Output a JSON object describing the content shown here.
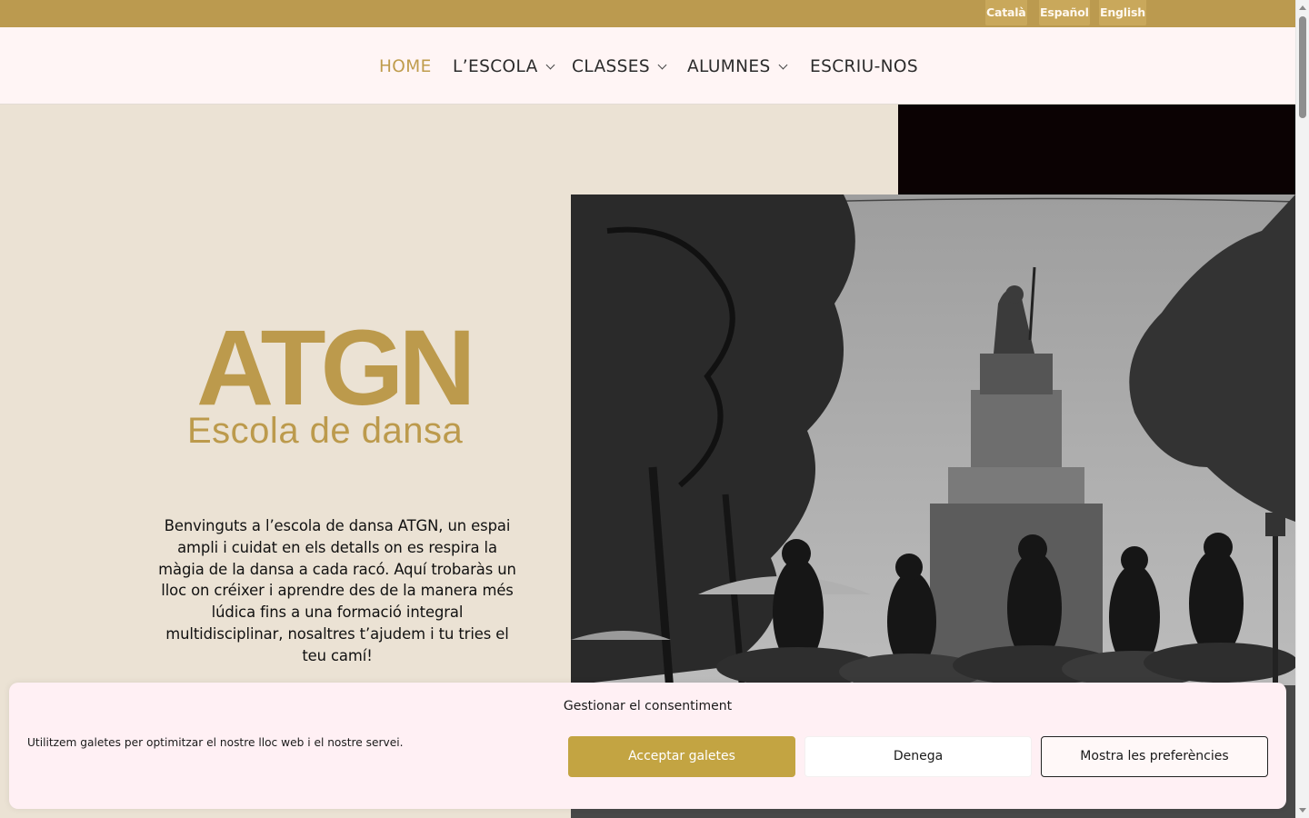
{
  "language_bar": {
    "languages": [
      "Català",
      "Español",
      "English"
    ],
    "background_color": "#bb9a4f"
  },
  "nav": {
    "items": [
      {
        "label": "HOME",
        "active": true
      },
      {
        "label": "L’ESCOLA",
        "has_dropdown": true
      },
      {
        "label": "CLASSES",
        "has_dropdown": true
      },
      {
        "label": "ALUMNES",
        "has_dropdown": true
      },
      {
        "label": "ESCRIU-NOS"
      }
    ],
    "active_color": "#bf9c4c"
  },
  "hero": {
    "logo_main": "ATGN",
    "logo_sub": "Escola de dansa",
    "logo_color": "#bc9a4c",
    "intro_text": "Benvinguts a l’escola de dansa ATGN, un espai ampli i cuidat en els detalls on es respira la màgia de la dansa a cada racó. Aquí trobaràs un lloc on créixer i aprendre des de la manera més lúdica fins a una formació integral multidisciplinar, nosaltres t’ajudem i tu tries el teu camí!",
    "background_color": "#ebe2d4"
  },
  "consent": {
    "title": "Gestionar el consentiment",
    "message": "Utilitzem galetes per optimitzar el nostre lloc web i el nostre servei.",
    "accept_label": "Acceptar galetes",
    "deny_label": "Denega",
    "prefs_label": "Mostra les preferències",
    "accent_color": "#c3a442"
  }
}
